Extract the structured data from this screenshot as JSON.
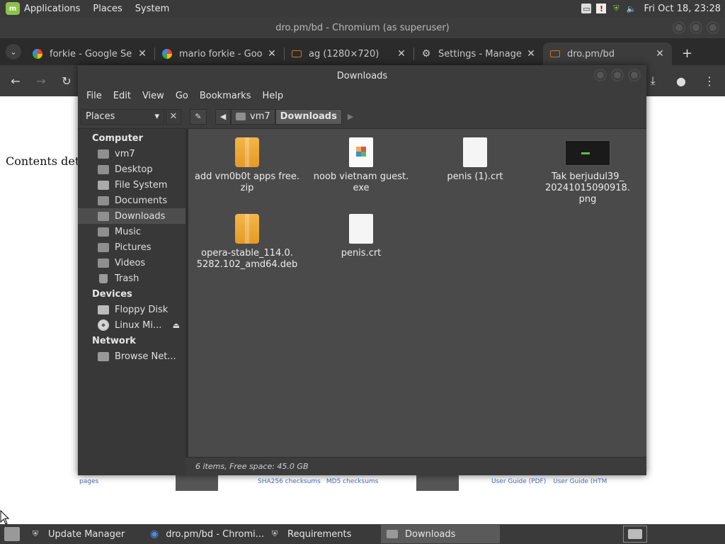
{
  "top_panel": {
    "menus": [
      "Applications",
      "Places",
      "System"
    ],
    "clock": "Fri Oct 18, 23:28"
  },
  "chromium": {
    "window_title": "dro.pm/bd - Chromium (as superuser)",
    "tabs": [
      {
        "label": "forkie - Google Se",
        "favicon": "google-icon"
      },
      {
        "label": "mario forkie - Goo",
        "favicon": "google-icon"
      },
      {
        "label": "ag (1280×720)",
        "favicon": "folder-icon"
      },
      {
        "label": "Settings - Manage",
        "favicon": "gear-icon"
      },
      {
        "label": "dro.pm/bd",
        "favicon": "folder-icon"
      }
    ],
    "page": {
      "contents_text": "Contents detec",
      "bottom_links": {
        "left": "pages",
        "sha256": "SHA256 checksums",
        "md5": "MD5 checksums",
        "guide_pdf": "User Guide (PDF)",
        "guide_html": "User Guide (HTM"
      }
    }
  },
  "file_manager": {
    "window_title": "Downloads",
    "menu": [
      "File",
      "Edit",
      "View",
      "Go",
      "Bookmarks",
      "Help"
    ],
    "places_selector": "Places",
    "breadcrumbs": [
      "vm7",
      "Downloads"
    ],
    "sidebar": {
      "computer": {
        "heading": "Computer",
        "items": [
          "vm7",
          "Desktop",
          "File System",
          "Documents",
          "Downloads",
          "Music",
          "Pictures",
          "Videos",
          "Trash"
        ]
      },
      "devices": {
        "heading": "Devices",
        "items": [
          "Floppy Disk",
          "Linux Mi..."
        ]
      },
      "network": {
        "heading": "Network",
        "items": [
          "Browse Net..."
        ]
      }
    },
    "files": [
      {
        "name": "add vm0b0t apps free.\nzip",
        "type": "zip"
      },
      {
        "name": "noob vietnam guest.\nexe",
        "type": "exe"
      },
      {
        "name": "penis (1).crt",
        "type": "doc"
      },
      {
        "name": "Tak berjudul39_\n20241015090918.\npng",
        "type": "img"
      },
      {
        "name": "opera-stable_114.0.\n5282.102_amd64.deb",
        "type": "zip"
      },
      {
        "name": "penis.crt",
        "type": "doc"
      }
    ],
    "status": "6 items, Free space: 45.0 GB"
  },
  "taskbar": {
    "tasks": [
      "Update Manager",
      "dro.pm/bd - Chromi...",
      "Requirements",
      "Downloads"
    ]
  }
}
